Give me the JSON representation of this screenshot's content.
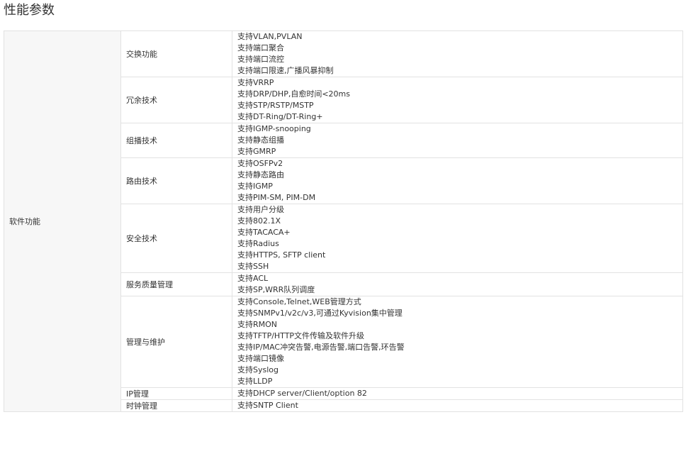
{
  "page": {
    "title": "性能参数"
  },
  "table": {
    "category": "软件功能",
    "rows": [
      {
        "feature": "交换功能",
        "details": [
          "支持VLAN,PVLAN",
          "支持端口聚合",
          "支持端口流控",
          "支持端口限速,广播风暴抑制"
        ]
      },
      {
        "feature": "冗余技术",
        "details": [
          "支持VRRP",
          "支持DRP/DHP,自愈时间<20ms",
          "支持STP/RSTP/MSTP",
          "支持DT-Ring/DT-Ring+"
        ]
      },
      {
        "feature": "组播技术",
        "details": [
          "支持IGMP-snooping",
          "支持静态组播",
          "支持GMRP"
        ]
      },
      {
        "feature": "路由技术",
        "details": [
          "支持OSFPv2",
          "支持静态路由",
          "支持IGMP",
          "支持PIM-SM, PIM-DM"
        ]
      },
      {
        "feature": "安全技术",
        "details": [
          "支持用户分级",
          "支持802.1X",
          "支持TACACA+",
          "支持Radius",
          "支持HTTPS, SFTP client",
          "支持SSH"
        ]
      },
      {
        "feature": "服务质量管理",
        "details": [
          "支持ACL",
          "支持SP,WRR队列调度"
        ]
      },
      {
        "feature": "管理与维护",
        "details": [
          "支持Console,Telnet,WEB管理方式",
          "支持SNMPv1/v2c/v3,可通过Kyvision集中管理",
          "支持RMON",
          "支持TFTP/HTTP文件传输及软件升级",
          "支持IP/MAC冲突告警,电源告警,端口告警,环告警",
          "支持端口镜像",
          "支持Syslog",
          "支持LLDP"
        ]
      },
      {
        "feature": "IP管理",
        "details": [
          "支持DHCP server/Client/option 82"
        ]
      },
      {
        "feature": "时钟管理",
        "details": [
          "支持SNTP Client"
        ]
      }
    ]
  }
}
